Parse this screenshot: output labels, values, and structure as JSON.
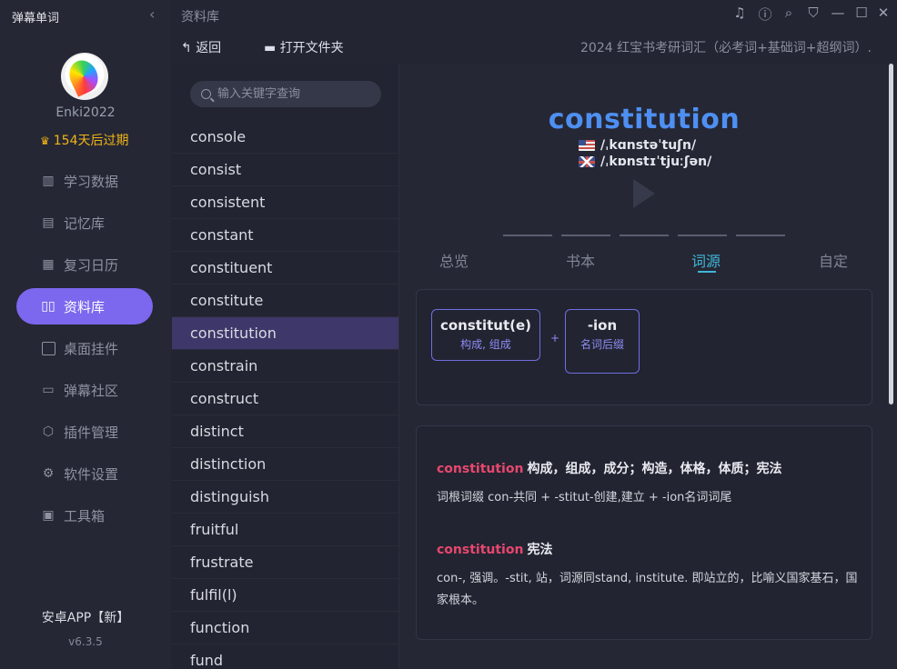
{
  "app": {
    "title": "弹幕单词",
    "collapse_icon": "chevron-left-icon"
  },
  "user": {
    "name": "Enki2022",
    "vip_status": "154天后过期"
  },
  "nav": [
    {
      "label": "学习数据",
      "icon": "bar-chart-icon"
    },
    {
      "label": "记忆库",
      "icon": "notebook-icon"
    },
    {
      "label": "复习日历",
      "icon": "calendar-icon"
    },
    {
      "label": "资料库",
      "icon": "library-icon",
      "active": true
    },
    {
      "label": "桌面挂件",
      "icon": "widget-icon"
    },
    {
      "label": "弹幕社区",
      "icon": "chat-icon"
    },
    {
      "label": "插件管理",
      "icon": "cube-icon"
    },
    {
      "label": "软件设置",
      "icon": "gear-icon"
    },
    {
      "label": "工具箱",
      "icon": "toolbox-icon"
    }
  ],
  "footer": {
    "android": "安卓APP【新】",
    "version": "v6.3.5"
  },
  "topbar": {
    "breadcrumb": "资料库",
    "back": "返回",
    "open_folder": "打开文件夹",
    "book_title": "2024 红宝书考研词汇（必考词+基础词+超纲词）."
  },
  "search": {
    "placeholder": "输入关键字查询"
  },
  "words": [
    "console",
    "consist",
    "consistent",
    "constant",
    "constituent",
    "constitute",
    "constitution",
    "constrain",
    "construct",
    "distinct",
    "distinction",
    "distinguish",
    "fruitful",
    "frustrate",
    "fulfil(l)",
    "function",
    "fund"
  ],
  "selected_word": "constitution",
  "detail": {
    "headword": "constitution",
    "phonetic_us": "/ˌkɑnstəˈtuʃn/",
    "phonetic_uk": "/ˌkɒnstɪˈtjuːʃən/",
    "tabs": [
      "总览",
      "书本",
      "词源",
      "自定"
    ],
    "active_tab": "词源",
    "morphemes": [
      {
        "part": "constitut(e)",
        "meaning": "构成, 组成"
      },
      {
        "part": "-ion",
        "meaning": "名词后缀"
      }
    ],
    "plus": "+",
    "etymology": [
      {
        "word": "constitution",
        "gloss": "构成，组成，成分；构造，体格，体质；宪法",
        "text": "词根词缀 con-共同 + -stitut-创建,建立 + -ion名词词尾"
      },
      {
        "word": "constitution",
        "gloss": "宪法",
        "text": "con-, 强调。-stit, 站，词源同stand, institute. 即站立的，比喻义国家基石，国家根本。"
      }
    ]
  },
  "colors": {
    "accent": "#7b68ee",
    "headword": "#4e8ff2",
    "tab_active": "#3fb6d8",
    "ety_word": "#e8476e",
    "vip": "#f2b518"
  }
}
